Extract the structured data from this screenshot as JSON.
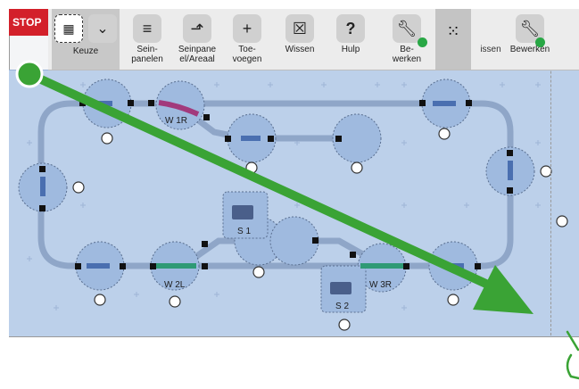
{
  "stop_label": "STOP",
  "toolbar": {
    "items": [
      {
        "label": "Keuze",
        "icon": "selection-icon"
      },
      {
        "label": "Sein-\npanelen",
        "icon": "signal-panels-icon"
      },
      {
        "label": "Seinpane\nel/Areaal",
        "icon": "signal-area-icon"
      },
      {
        "label": "Toe-\nvoegen",
        "icon": "add-icon"
      },
      {
        "label": "Wissen",
        "icon": "trash-icon"
      },
      {
        "label": "Hulp",
        "icon": "help-icon"
      },
      {
        "label": "Be-\nwerken",
        "icon": "wrench-icon"
      }
    ],
    "behind_labels": [
      "issen",
      "Bewerken"
    ],
    "help_glyph": "?"
  },
  "layout": {
    "blocks": [
      {
        "label": "W 1R"
      },
      {
        "label": "W 2L"
      },
      {
        "label": "W 3R"
      },
      {
        "label": "S 1"
      },
      {
        "label": "S 2"
      }
    ]
  },
  "colors": {
    "layout_bg": "#bcd0ea",
    "track": "#8fa6c8",
    "node_fill": "#9fbadf",
    "arrow": "#3aa335",
    "stop_red": "#d3202a",
    "turnout_purple": "#a23a7c",
    "turnout_green": "#2f9a75"
  }
}
